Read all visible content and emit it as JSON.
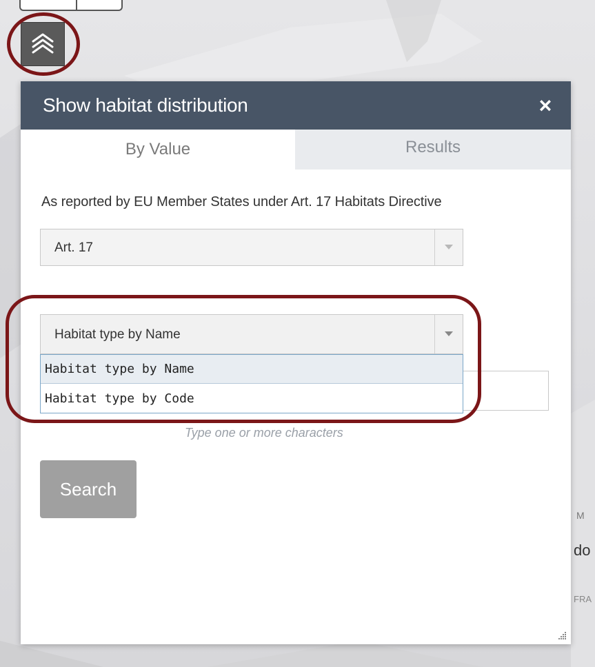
{
  "panel": {
    "title": "Show habitat distribution",
    "close_label": "×",
    "tabs": [
      {
        "label": "By Value",
        "active": true
      },
      {
        "label": "Results",
        "active": false
      }
    ],
    "description": "As reported by EU Member States under Art. 17 Habitats Directive",
    "source_select": {
      "value": "Art. 17"
    },
    "type_select": {
      "value": "Habitat type by Name",
      "options": [
        "Habitat type by Name",
        "Habitat type by Code"
      ]
    },
    "input_hint": "Type one or more characters",
    "search_label": "Search"
  },
  "map": {
    "labels": [
      "M",
      "do",
      "FRA"
    ]
  },
  "colors": {
    "header": "#485566",
    "highlight_ring": "#7b1618",
    "search_button": "#a0a0a0"
  },
  "icons": {
    "layer_toggle": "stacked-layers-icon",
    "dropdown_arrow": "caret-down-icon",
    "close": "close-icon",
    "resize": "resize-grip-icon"
  }
}
